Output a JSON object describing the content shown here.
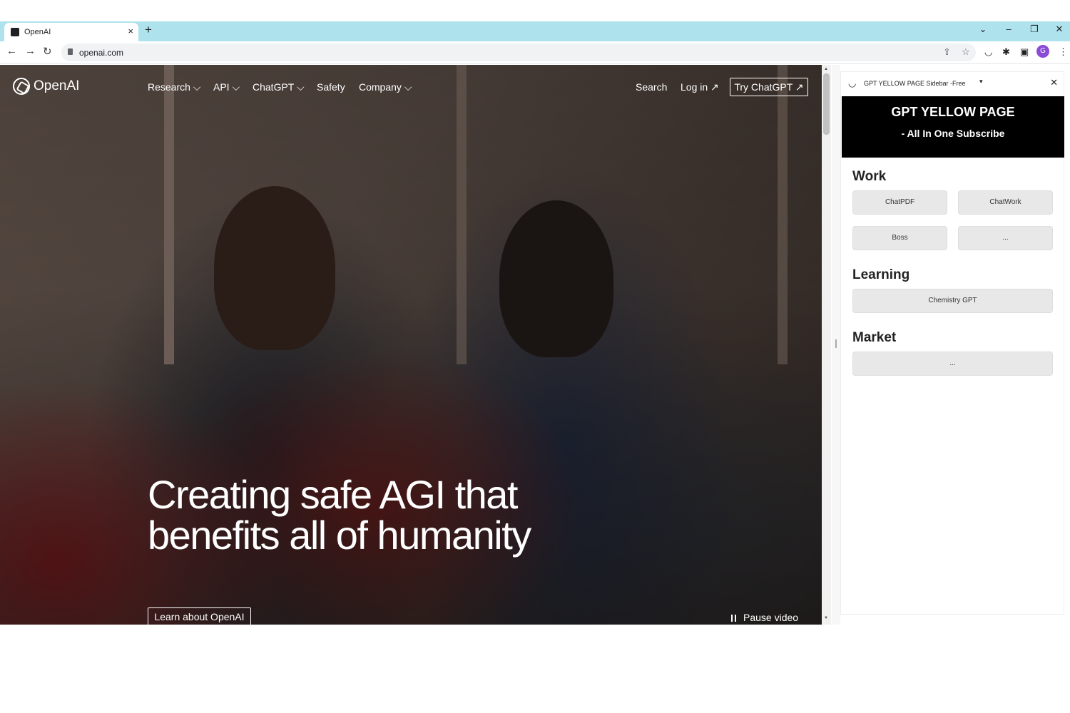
{
  "browser": {
    "tab_title": "OpenAI",
    "tab_close": "×",
    "new_tab": "+",
    "url": "openai.com",
    "window_controls": {
      "tab_search": "⌄",
      "minimize": "–",
      "restore": "❐",
      "close": "✕"
    },
    "nav": {
      "back": "←",
      "forward": "→",
      "reload": "↻"
    },
    "profile_initial": "G",
    "omnibox_icons": {
      "share": "⇪",
      "bookmark": "☆"
    },
    "extension_icons": {
      "gpt_extension": "◡",
      "extensions": "✱",
      "side_panel": "▣",
      "menu": "⋮"
    }
  },
  "site": {
    "logo": "OpenAI",
    "nav": [
      {
        "label": "Research ⌵"
      },
      {
        "label": "API ⌵"
      },
      {
        "label": "ChatGPT ⌵"
      },
      {
        "label": "Safety"
      },
      {
        "label": "Company ⌵"
      }
    ],
    "search_label": "Search",
    "login_label": "Log in ↗",
    "try_label": "Try ChatGPT ↗",
    "hero_line1": "Creating safe AGI that",
    "hero_line2": "benefits all of humanity",
    "learn_label": "Learn about OpenAI",
    "pause_label": "Pause video"
  },
  "sidepanel": {
    "title": "GPT YELLOW PAGE Sidebar -Free",
    "caret": "▾",
    "close": "✕",
    "logo_glyph": "◡",
    "banner_title": "GPT YELLOW PAGE",
    "banner_subtitle": "- All In One Subscribe",
    "sections": [
      {
        "heading": "Work",
        "items": [
          "ChatPDF",
          "ChatWork",
          "Boss",
          "..."
        ]
      },
      {
        "heading": "Learning",
        "items": [
          "Chemistry GPT"
        ]
      },
      {
        "heading": "Market",
        "items": [
          "..."
        ]
      }
    ]
  },
  "scrollbar": {
    "up": "▲",
    "down": "▼"
  },
  "colors": {
    "tabstrip": "#aee3ee",
    "banner": "#000000",
    "button_bg": "#e8e8e8",
    "profile": "#8a4bd6"
  }
}
